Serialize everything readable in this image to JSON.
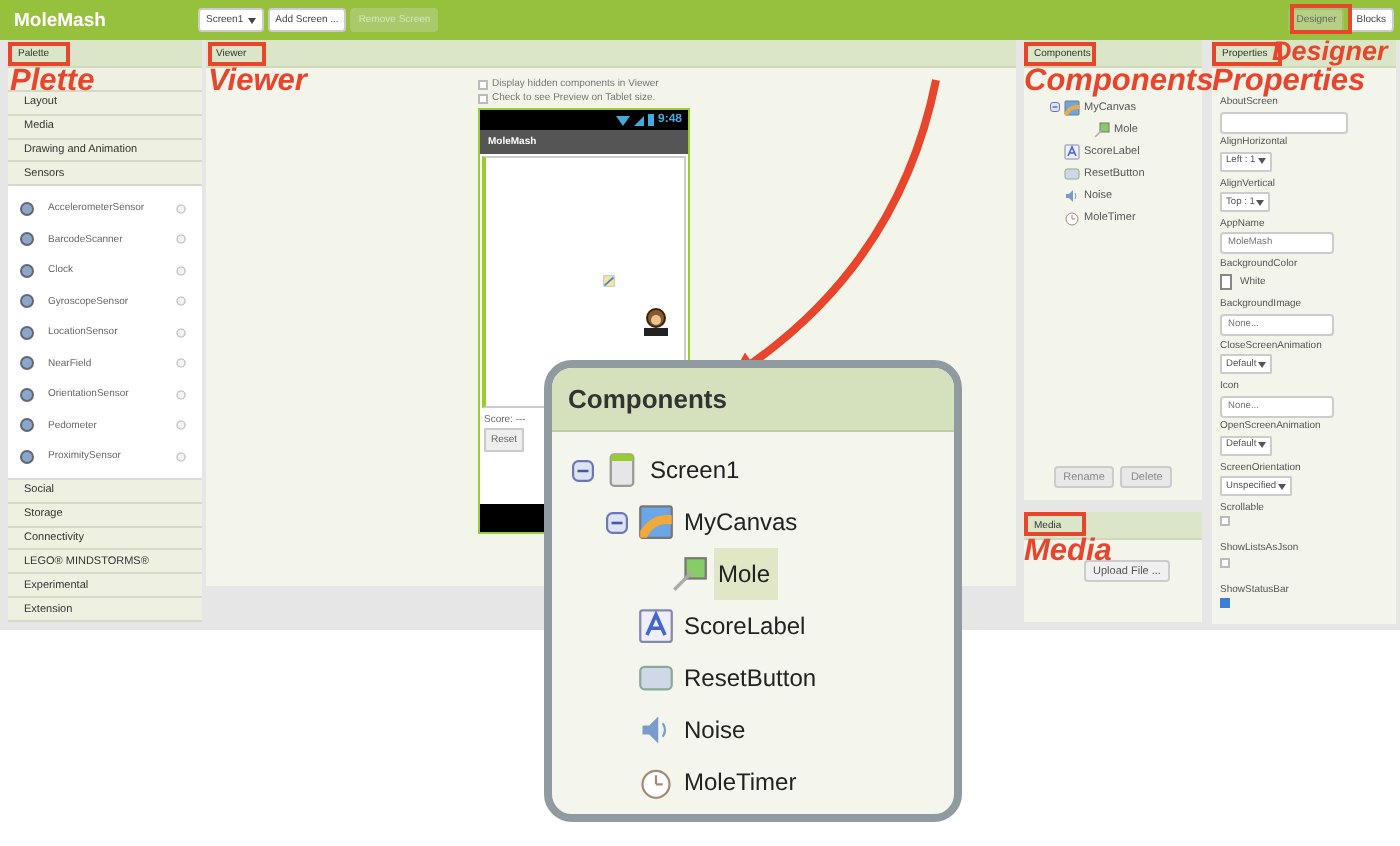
{
  "app_bar": {
    "title": "MoleMash",
    "screen_menu": "Screen1",
    "add_screen": "Add Screen ...",
    "remove_screen": {
      "label": "Remove Screen",
      "disabled": true
    },
    "modes": [
      {
        "label": "Designer",
        "selected": true
      },
      {
        "label": "Blocks",
        "selected": false
      }
    ]
  },
  "palette": {
    "header": "Palette",
    "categories_top": [
      "Layout",
      "Media",
      "Drawing and Animation",
      "Sensors"
    ],
    "sensors": [
      "AccelerometerSensor",
      "BarcodeScanner",
      "Clock",
      "GyroscopeSensor",
      "LocationSensor",
      "NearField",
      "OrientationSensor",
      "Pedometer",
      "ProximitySensor"
    ],
    "categories_bottom": [
      "Social",
      "Storage",
      "Connectivity",
      "LEGO® MINDSTORMS®",
      "Experimental",
      "Extension"
    ]
  },
  "viewer": {
    "header": "Viewer",
    "options": [
      {
        "label": "Display hidden components in Viewer",
        "checked": false
      },
      {
        "label": "Check to see Preview on Tablet size.",
        "checked": false
      }
    ],
    "phone": {
      "time": "9:48",
      "app_title": "MoleMash",
      "score": "Score: ---",
      "reset_button": "Reset"
    }
  },
  "components": {
    "header": "Components",
    "tree": [
      {
        "name": "MyCanvas",
        "kind": "canvas",
        "expanded": true,
        "selected": false,
        "children": [
          {
            "name": "Mole",
            "kind": "sprite",
            "selected": false
          }
        ]
      },
      {
        "name": "ScoreLabel",
        "kind": "label",
        "selected": false
      },
      {
        "name": "ResetButton",
        "kind": "button",
        "selected": false
      },
      {
        "name": "Noise",
        "kind": "sound",
        "selected": false
      },
      {
        "name": "MoleTimer",
        "kind": "clock",
        "selected": false
      }
    ],
    "buttons": [
      "Rename",
      "Delete"
    ]
  },
  "media": {
    "header": "Media",
    "upload_button": "Upload File ..."
  },
  "properties": {
    "header": "Properties",
    "items": [
      {
        "kind": "textarea",
        "label": "AboutScreen"
      },
      {
        "kind": "dropdown",
        "label": "AlignHorizontal",
        "value": "Left : 1"
      },
      {
        "kind": "dropdown",
        "label": "AlignVertical",
        "value": "Top : 1"
      },
      {
        "kind": "text",
        "label": "AppName",
        "value": "MoleMash"
      },
      {
        "kind": "color",
        "label": "BackgroundColor",
        "value": "White"
      },
      {
        "kind": "text",
        "label": "BackgroundImage",
        "value": "None..."
      },
      {
        "kind": "dropdown",
        "label": "CloseScreenAnimation",
        "value": "Default"
      },
      {
        "kind": "text",
        "label": "Icon",
        "value": "None..."
      },
      {
        "kind": "dropdown",
        "label": "OpenScreenAnimation",
        "value": "Default"
      },
      {
        "kind": "dropdown",
        "label": "ScreenOrientation",
        "value": "Unspecified"
      },
      {
        "kind": "checkbox",
        "label": "Scrollable",
        "checked": false
      },
      {
        "kind": "checkbox",
        "label": "ShowListsAsJson",
        "checked": false
      },
      {
        "kind": "checkbox",
        "label": "ShowStatusBar",
        "checked": true
      }
    ]
  },
  "zoom_card": {
    "title": "Components",
    "tree": [
      {
        "name": "Screen1",
        "kind": "screen",
        "expanded": true,
        "selected": false,
        "children": [
          {
            "name": "MyCanvas",
            "kind": "canvas",
            "expanded": true,
            "selected": false,
            "children": [
              {
                "name": "Mole",
                "kind": "sprite",
                "selected": true
              }
            ]
          },
          {
            "name": "ScoreLabel",
            "kind": "label",
            "selected": false
          },
          {
            "name": "ResetButton",
            "kind": "button",
            "selected": false
          },
          {
            "name": "Noise",
            "kind": "sound",
            "selected": false
          },
          {
            "name": "MoleTimer",
            "kind": "clock",
            "selected": false
          }
        ]
      }
    ]
  },
  "annotations": [
    {
      "kind": "palette",
      "label": "Plette"
    },
    {
      "kind": "viewer",
      "label": "Viewer"
    },
    {
      "kind": "components",
      "label": "Components"
    },
    {
      "kind": "properties",
      "label": "Properties"
    },
    {
      "kind": "designer",
      "label": "Designer"
    },
    {
      "kind": "media",
      "label": "Media"
    }
  ]
}
